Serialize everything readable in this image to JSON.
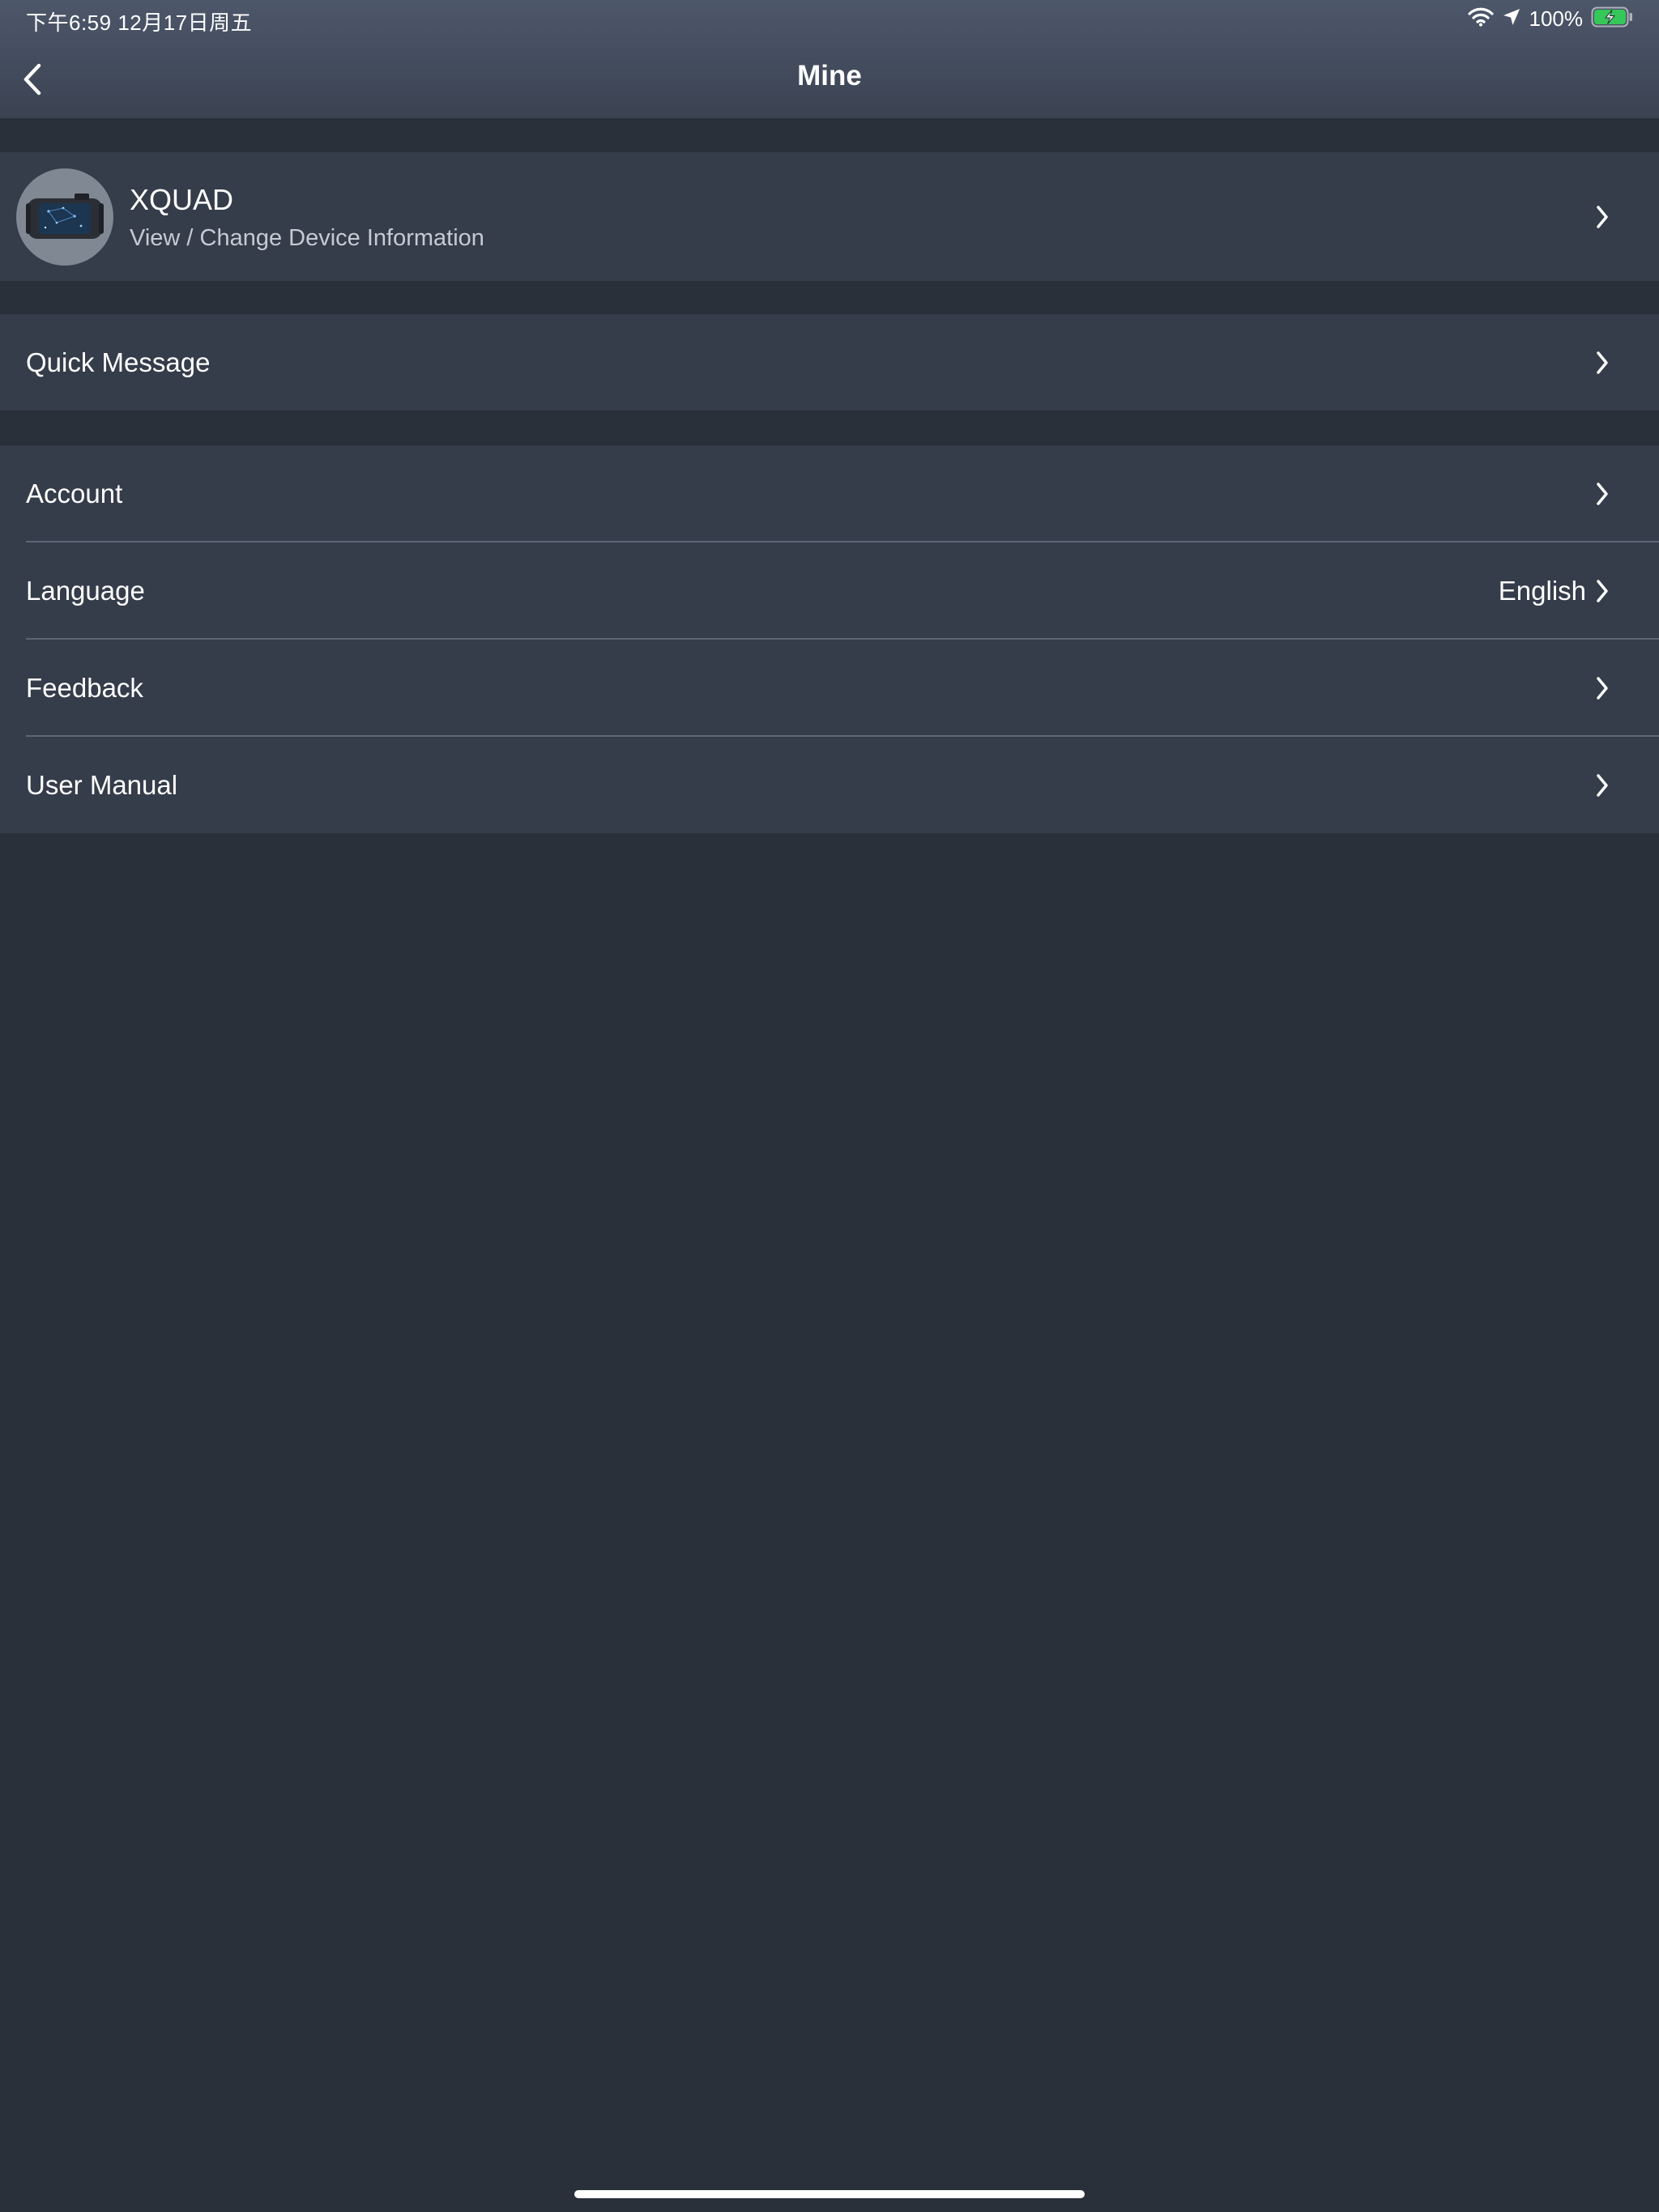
{
  "status_bar": {
    "time_date": "下午6:59   12月17日周五",
    "battery_percent": "100%",
    "icons": [
      "wifi-icon",
      "location-arrow-icon",
      "battery-charging-icon"
    ]
  },
  "nav": {
    "title": "Mine",
    "back_icon": "chevron-left-icon"
  },
  "device": {
    "name": "XQUAD",
    "subtitle": "View / Change Device Information"
  },
  "quick": {
    "label": "Quick Message"
  },
  "settings": {
    "account": {
      "label": "Account"
    },
    "language": {
      "label": "Language",
      "value": "English"
    },
    "feedback": {
      "label": "Feedback"
    },
    "manual": {
      "label": "User Manual"
    }
  },
  "colors": {
    "background": "#29303a",
    "row_background": "#353c4a",
    "battery_green": "#35c759"
  }
}
